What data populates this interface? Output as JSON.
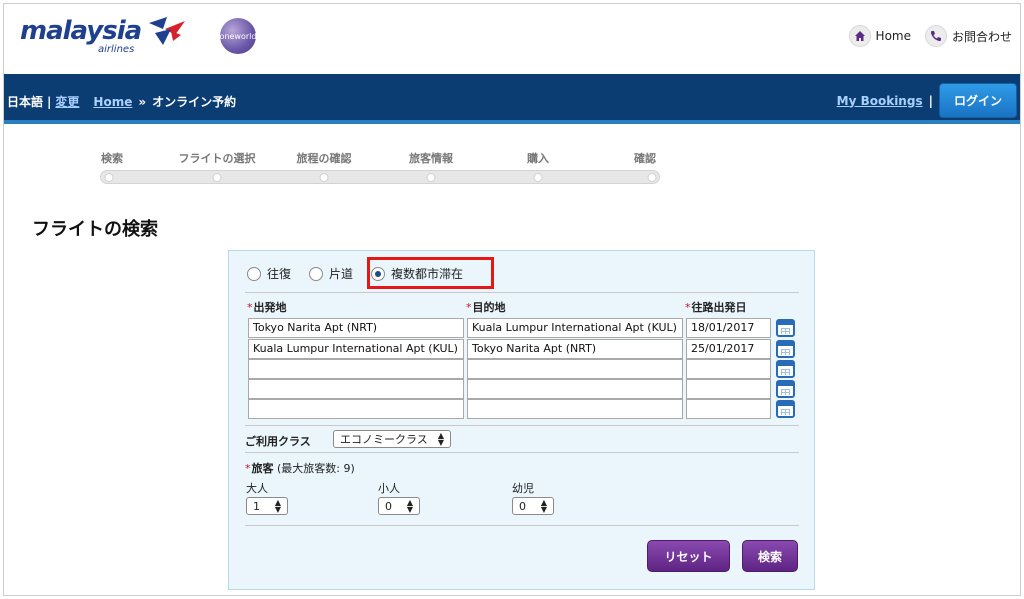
{
  "brand": {
    "logo_text": "malaysia",
    "logo_sub": "airlines",
    "oneworld_text": "oneworld"
  },
  "top_links": {
    "home": "Home",
    "contact": "お問合わせ"
  },
  "nav": {
    "language": "日本語",
    "sep1": "|",
    "change": "変更",
    "home": "Home",
    "arrow": "»",
    "current": "オンライン予約",
    "my_bookings": "My Bookings",
    "sep2": "|",
    "login": "ログイン"
  },
  "progress_steps": [
    "検索",
    "フライトの選択",
    "旅程の確認",
    "旅客情報",
    "購入",
    "確認"
  ],
  "page_title": "フライトの検索",
  "trip_types": {
    "round_trip": "往復",
    "one_way": "片道",
    "multi_city": "複数都市滞在",
    "selected": "multi_city"
  },
  "columns": {
    "origin": "出発地",
    "destination": "目的地",
    "depart_date": "往路出発日",
    "required_mark": "*"
  },
  "legs": [
    {
      "origin": "Tokyo Narita Apt (NRT)",
      "destination": "Kuala Lumpur International Apt (KUL)",
      "date": "18/01/2017"
    },
    {
      "origin": "Kuala Lumpur International Apt (KUL)",
      "destination": "Tokyo Narita Apt (NRT)",
      "date": "25/01/2017"
    },
    {
      "origin": "",
      "destination": "",
      "date": ""
    },
    {
      "origin": "",
      "destination": "",
      "date": ""
    },
    {
      "origin": "",
      "destination": "",
      "date": ""
    }
  ],
  "cabin": {
    "label": "ご利用クラス",
    "value": "エコノミークラス"
  },
  "passengers": {
    "label": "旅客",
    "note": "(最大旅客数: 9)",
    "adult_label": "大人",
    "adult_value": "1",
    "child_label": "小人",
    "child_value": "0",
    "infant_label": "幼児",
    "infant_value": "0"
  },
  "buttons": {
    "reset": "リセット",
    "search": "検索"
  },
  "colors": {
    "nav_bg": "#0b3d73",
    "accent_purple": "#5e2483",
    "panel_bg": "#eaf6fb",
    "highlight": "#e51818"
  }
}
